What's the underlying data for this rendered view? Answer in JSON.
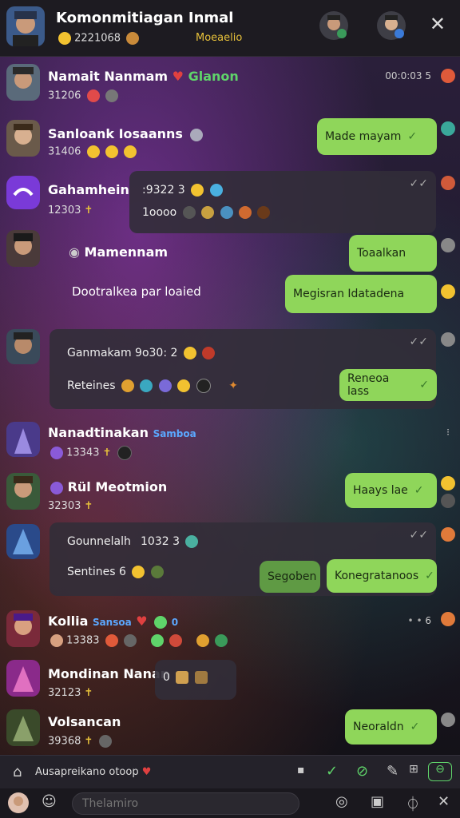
{
  "header": {
    "title": "Komonmitiagan Inmal",
    "subtitle": "2221068",
    "subtitle2": "Moeaelio"
  },
  "rows": {
    "r1": {
      "name": "Namait Nanmam",
      "tag": "Glanon",
      "meta": "31206",
      "time": "00:0:03 5"
    },
    "r2": {
      "name": "Sanloank Iosaanns",
      "meta": "31406",
      "bubble": "Made mayam"
    },
    "r3": {
      "name": "Gahamhein",
      "meta": "12303",
      "line1": ":9322 3",
      "line2": "1oooo"
    },
    "r4": {
      "name": "Mamennam",
      "line": "Dootralkea par loaied",
      "bubble1": "Toaalkan",
      "bubble2": "Megisran Idatadena"
    },
    "r5": {
      "line1": "Ganmakam 9o30: 2",
      "line2": "Reteines",
      "bubble": "Reneoa lass"
    },
    "r6": {
      "name": "Nanadtinakan",
      "tag": "Samboa",
      "meta": "13343"
    },
    "r7": {
      "name": "Rül Meotmion",
      "meta": "32303",
      "bubble": "Haays lae"
    },
    "r8": {
      "line1": "Gounnelalh",
      "line1b": "1032 3",
      "line2": "Sentines 6",
      "bubble1": "Segoben",
      "bubble2": "Konegratanoos"
    },
    "r9": {
      "name": "Kollia",
      "tag": "Sansoa",
      "tag2": "0",
      "meta": "13383",
      "time": "6"
    },
    "r10": {
      "name": "Mondinan Nanan",
      "meta": "32123",
      "box": "0"
    },
    "r11": {
      "name": "Volsancan",
      "meta": "39368",
      "bubble": "Neoraldn"
    }
  },
  "composer": {
    "status": "Ausapreikano otoop",
    "placeholder": "Thelamiro"
  },
  "colors": {
    "green_bubble": "#8fd65a",
    "header_bg": "#1d1b21",
    "accent_gold": "#e7c13a"
  }
}
